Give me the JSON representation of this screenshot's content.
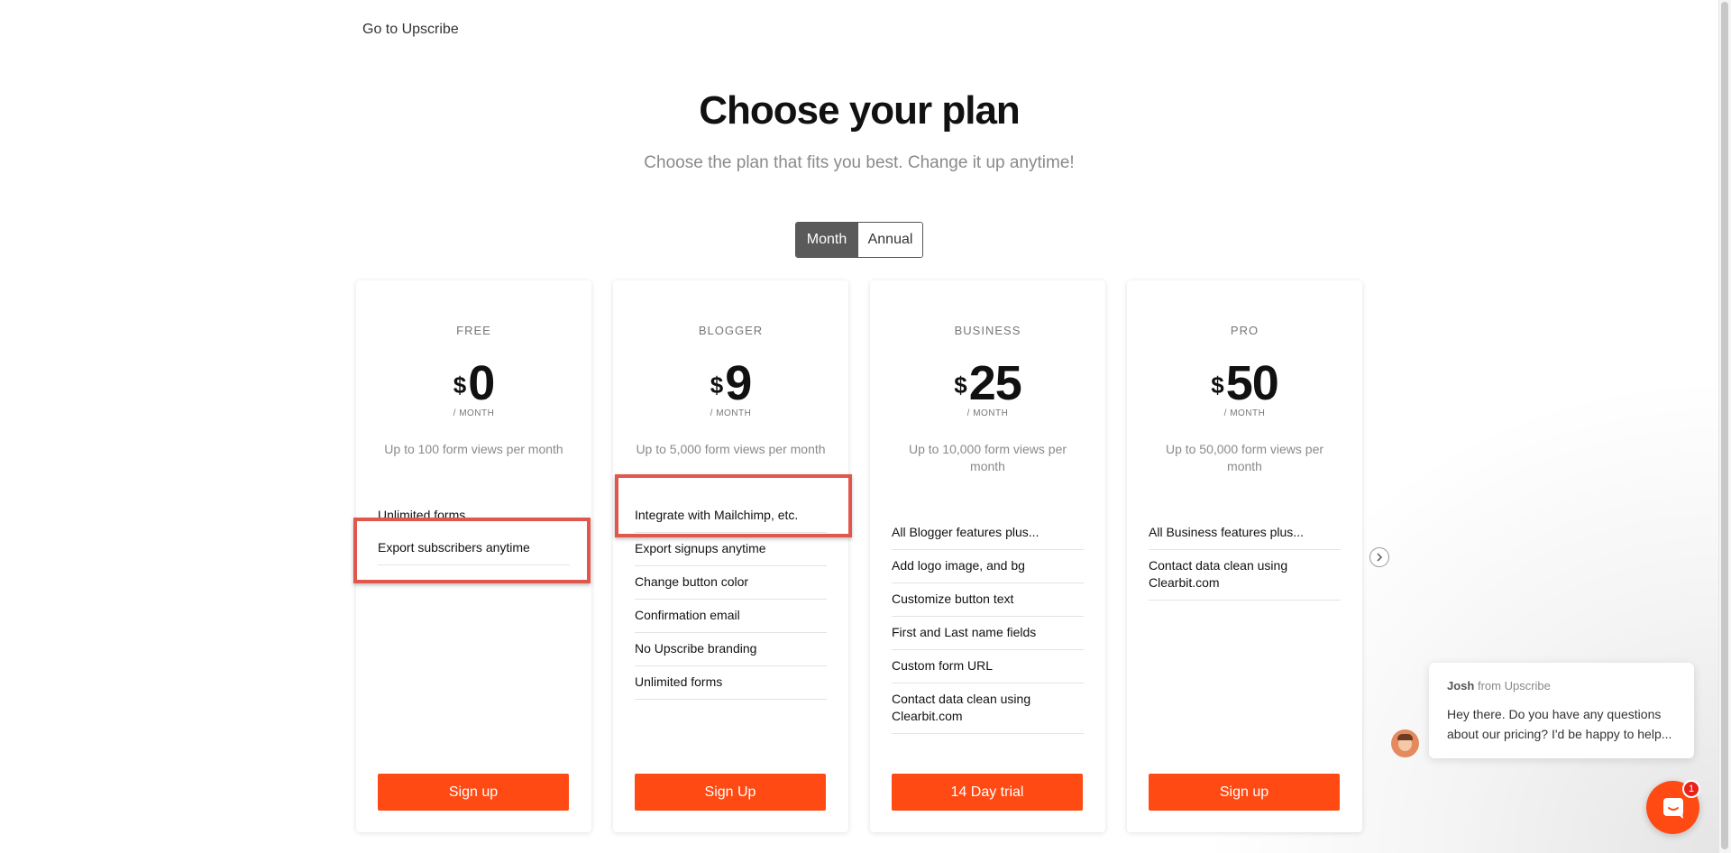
{
  "nav": {
    "back_link": "Go to Upscribe"
  },
  "header": {
    "title": "Choose your plan",
    "subtitle": "Choose the plan that fits you best. Change it up anytime!"
  },
  "billing_toggle": {
    "month_label": "Month",
    "annual_label": "Annual",
    "selected": "Month"
  },
  "plans": [
    {
      "name": "FREE",
      "currency": "$",
      "price": "0",
      "period": "/ MONTH",
      "views": "Up to 100 form views per month",
      "features": [
        "Unlimited forms",
        "Export subscribers anytime"
      ],
      "cta": "Sign up"
    },
    {
      "name": "BLOGGER",
      "currency": "$",
      "price": "9",
      "period": "/ MONTH",
      "views": "Up to 5,000 form views per month",
      "features": [
        "Integrate with Mailchimp, etc.",
        "Export signups anytime",
        "Change button color",
        "Confirmation email",
        "No Upscribe branding",
        "Unlimited forms"
      ],
      "cta": "Sign Up"
    },
    {
      "name": "BUSINESS",
      "currency": "$",
      "price": "25",
      "period": "/ MONTH",
      "views": "Up to 10,000 form views per month",
      "features": [
        "All Blogger features plus...",
        "Add logo image, and bg",
        "Customize button text",
        "First and Last name fields",
        "Custom form URL",
        "Contact data clean using Clearbit.com"
      ],
      "cta": "14 Day trial"
    },
    {
      "name": "PRO",
      "currency": "$",
      "price": "50",
      "period": "/ MONTH",
      "views": "Up to 50,000 form views per month",
      "features": [
        "All Business features plus...",
        "Contact data clean using Clearbit.com"
      ],
      "cta": "Sign up"
    }
  ],
  "carousel": {
    "next_icon": "chevron-right-icon"
  },
  "chat": {
    "sender": "Josh",
    "sender_suffix": "from Upscribe",
    "message": "Hey there. Do you have any questions about our pricing? I'd be happy to help...",
    "unread_count": "1",
    "launcher_icon": "chat-icon"
  },
  "colors": {
    "accent": "#ff4a14",
    "highlight": "#e0574c",
    "toggle_active": "#5a5a5a"
  }
}
